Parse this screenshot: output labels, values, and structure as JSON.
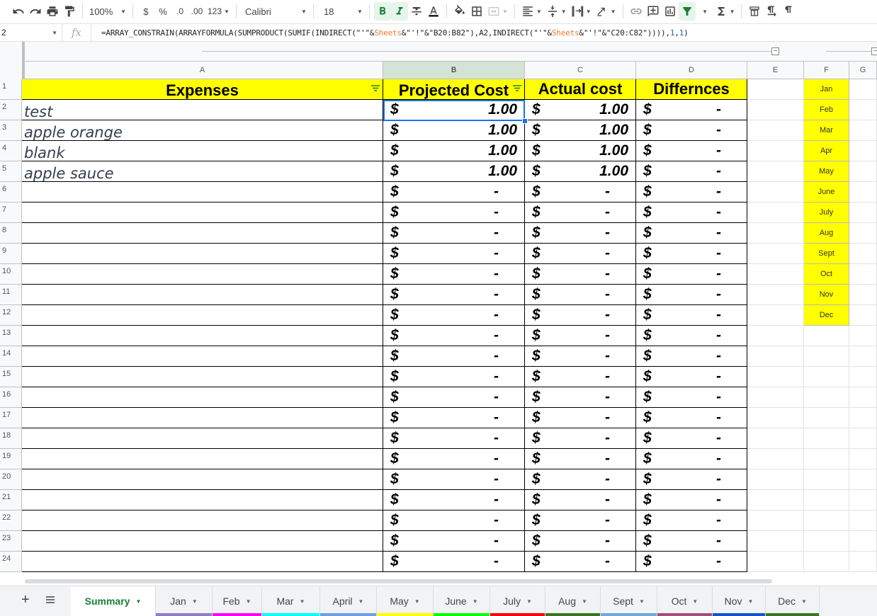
{
  "toolbar": {
    "zoom": "100%",
    "currency": "$",
    "percent": "%",
    "decrease_decimal": ".0",
    "increase_decimal": ".00",
    "more_formats": "123",
    "font": "Calibri",
    "font_size": "18"
  },
  "formula_bar": {
    "name_box": "2",
    "fx": "fx",
    "formula_parts": [
      {
        "t": "=ARRAY_CONSTRAIN(ARRAYFORMULA(SUMPRODUCT(SUMIF(INDIRECT(\"'\"&",
        "c": "str"
      },
      {
        "t": "Sheets",
        "c": "ref"
      },
      {
        "t": "&\"'!\"&\"B20:B82\"),A2,INDIRECT(\"'\"&",
        "c": "str"
      },
      {
        "t": "Sheets",
        "c": "ref"
      },
      {
        "t": "&\"'!\"&\"C20:C82\")))), ",
        "c": "str"
      },
      {
        "t": "1",
        "c": "num"
      },
      {
        "t": ", ",
        "c": "str"
      },
      {
        "t": "1",
        "c": "num"
      },
      {
        "t": ")",
        "c": "str"
      }
    ]
  },
  "columns": [
    "A",
    "B",
    "C",
    "D",
    "E",
    "F",
    "G"
  ],
  "headers": {
    "expenses": "Expenses",
    "projected": "Projected Cost",
    "actual": "Actual cost",
    "difference": "Differnces"
  },
  "currency_symbol": "$",
  "rows": [
    {
      "num": "1"
    },
    {
      "num": "2",
      "expense": "test",
      "projected": "1.00",
      "actual": "1.00",
      "diff": "-"
    },
    {
      "num": "3",
      "expense": "apple  orange",
      "projected": "1.00",
      "actual": "1.00",
      "diff": "-"
    },
    {
      "num": "4",
      "expense": "blank",
      "projected": "1.00",
      "actual": "1.00",
      "diff": "-"
    },
    {
      "num": "5",
      "expense": "apple sauce",
      "projected": "1.00",
      "actual": "1.00",
      "diff": "-"
    },
    {
      "num": "6",
      "expense": "",
      "projected": "-",
      "actual": "-",
      "diff": "-"
    },
    {
      "num": "7",
      "expense": "",
      "projected": "-",
      "actual": "-",
      "diff": "-"
    },
    {
      "num": "8",
      "expense": "",
      "projected": "-",
      "actual": "-",
      "diff": "-"
    },
    {
      "num": "9",
      "expense": "",
      "projected": "-",
      "actual": "-",
      "diff": "-"
    },
    {
      "num": "10",
      "expense": "",
      "projected": "-",
      "actual": "-",
      "diff": "-"
    },
    {
      "num": "11",
      "expense": "",
      "projected": "-",
      "actual": "-",
      "diff": "-"
    },
    {
      "num": "12",
      "expense": "",
      "projected": "-",
      "actual": "-",
      "diff": "-"
    },
    {
      "num": "13",
      "expense": "",
      "projected": "-",
      "actual": "-",
      "diff": "-"
    },
    {
      "num": "14",
      "expense": "",
      "projected": "-",
      "actual": "-",
      "diff": "-"
    },
    {
      "num": "15",
      "expense": "",
      "projected": "-",
      "actual": "-",
      "diff": "-"
    },
    {
      "num": "16",
      "expense": "",
      "projected": "-",
      "actual": "-",
      "diff": "-"
    },
    {
      "num": "17",
      "expense": "",
      "projected": "-",
      "actual": "-",
      "diff": "-"
    },
    {
      "num": "18",
      "expense": "",
      "projected": "-",
      "actual": "-",
      "diff": "-"
    },
    {
      "num": "19",
      "expense": "",
      "projected": "-",
      "actual": "-",
      "diff": "-"
    },
    {
      "num": "20",
      "expense": "",
      "projected": "-",
      "actual": "-",
      "diff": "-"
    },
    {
      "num": "21",
      "expense": "",
      "projected": "-",
      "actual": "-",
      "diff": "-"
    },
    {
      "num": "22",
      "expense": "",
      "projected": "-",
      "actual": "-",
      "diff": "-"
    },
    {
      "num": "23",
      "expense": "",
      "projected": "-",
      "actual": "-",
      "diff": "-"
    },
    {
      "num": "24",
      "expense": "",
      "projected": "-",
      "actual": "-",
      "diff": "-"
    }
  ],
  "months": [
    "Jan",
    "Feb",
    "Mar",
    "Apr",
    "May",
    "June",
    "July",
    "Aug",
    "Sept",
    "Oct",
    "Nov",
    "Dec"
  ],
  "sheets": {
    "add_label": "+",
    "active": "Summary",
    "tabs": [
      {
        "label": "Summary",
        "color": ""
      },
      {
        "label": "Jan",
        "color": "#8e7cc3"
      },
      {
        "label": "Feb",
        "color": "#ff00ff"
      },
      {
        "label": "Mar",
        "color": "#00ffff"
      },
      {
        "label": "April",
        "color": "#6d9eeb"
      },
      {
        "label": "May",
        "color": "#ffff00"
      },
      {
        "label": "June",
        "color": "#00ff00"
      },
      {
        "label": "July",
        "color": "#ff0000"
      },
      {
        "label": "Aug",
        "color": "#38761d"
      },
      {
        "label": "Sept",
        "color": "#6fa8dc"
      },
      {
        "label": "Oct",
        "color": "#a64d79"
      },
      {
        "label": "Nov",
        "color": "#1155cc"
      },
      {
        "label": "Dec",
        "color": "#38761d"
      }
    ]
  },
  "colors": {
    "header_fill": "#ffff00",
    "selection": "#1a73e8",
    "active_tab_text": "#188038",
    "formula_ref": "#e67c2c",
    "formula_number": "#1a66c8"
  }
}
